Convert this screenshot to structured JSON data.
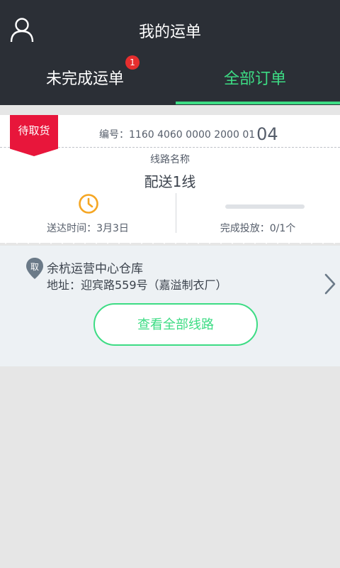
{
  "header": {
    "title": "我的运单",
    "user_icon": "user-icon",
    "tabs": [
      {
        "label": "未完成运单",
        "badge": "1",
        "active": false
      },
      {
        "label": "全部订单",
        "active": true
      }
    ]
  },
  "order": {
    "status": "待取货",
    "number_prefix": "编号：1160 4060 0000 2000 01",
    "number_tail": "04",
    "route_label": "线路名称",
    "route_name": "配送1线",
    "delivery_time": "送达时间：3月3日",
    "progress_text": "完成投放：0/1个",
    "progress_fraction": 0,
    "pickup_tag": "取",
    "warehouse": "余杭运营中心仓库",
    "address": "地址：迎宾路559号（嘉溢制衣厂）",
    "view_all_button": "查看全部线路"
  },
  "colors": {
    "header_bg": "#2b2f36",
    "accent_green": "#3ddc84",
    "status_red": "#e8163b",
    "badge_red": "#e62e2e",
    "clock_orange": "#f5a623"
  }
}
